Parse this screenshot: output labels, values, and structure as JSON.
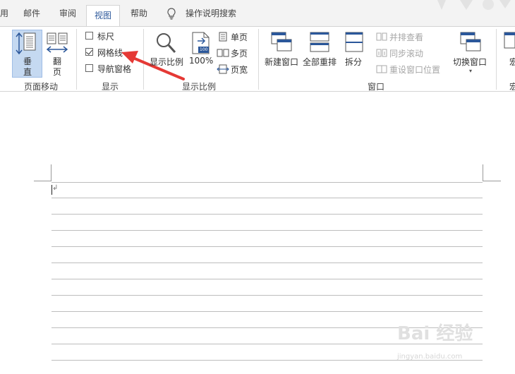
{
  "tabs": {
    "partial": "用",
    "mail": "邮件",
    "review": "审阅",
    "view": "视图",
    "help": "帮助",
    "tell_me": "操作说明搜索"
  },
  "ribbon": {
    "page_movement": {
      "vertical": "垂\n直",
      "vertical_top": "垂",
      "vertical_bottom": "直",
      "flip_top": "翻",
      "flip_bottom": "页",
      "group_label": "页面移动"
    },
    "show": {
      "ruler": "标尺",
      "gridlines": "网格线",
      "nav_pane": "导航窗格",
      "group_label": "显示",
      "ruler_checked": false,
      "gridlines_checked": true,
      "nav_pane_checked": false
    },
    "zoom": {
      "zoom": "显示比例",
      "hundred": "100%",
      "hundred_icon_text": "100",
      "one_page": "单页",
      "multi_page": "多页",
      "page_width": "页宽",
      "group_label": "显示比例"
    },
    "window": {
      "new_window": "新建窗口",
      "arrange_all": "全部重排",
      "split": "拆分",
      "side_by_side": "并排查看",
      "sync_scroll": "同步滚动",
      "reset_position": "重设窗口位置",
      "switch_windows": "切换窗口",
      "group_label": "窗口"
    },
    "macros": {
      "partial_label": "宏",
      "partial_group": "宏"
    }
  },
  "document": {
    "paragraph_mark": "↲"
  },
  "watermark": {
    "text": "Bai 经验",
    "url": "jingyan.baidu.com"
  },
  "colors": {
    "accent": "#2b579a",
    "arrow": "#e53935"
  }
}
